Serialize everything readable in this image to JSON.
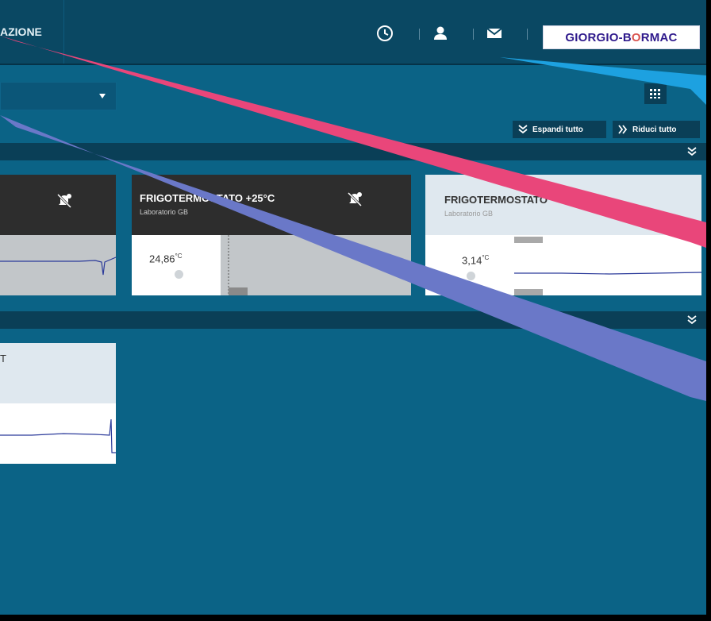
{
  "nav": {
    "configuration_tab_label": "AZIONE"
  },
  "brand": {
    "logo_part1": "GIORGIO-B",
    "logo_o": "O",
    "logo_part2": "RMAC"
  },
  "toolbar": {
    "expand_all_label": "Espandi tutto",
    "collapse_all_label": "Riduci tutto"
  },
  "cards": [
    {
      "title": "",
      "subtitle": "",
      "reading": "",
      "unit": ""
    },
    {
      "title": "FRIGOTERMOSTATO +25°C",
      "subtitle": "Laboratorio GB",
      "reading": "24,86",
      "unit": "°C"
    },
    {
      "title": "FRIGOTERMOSTATO",
      "subtitle": "Laboratorio GB",
      "reading": "3,14",
      "unit": "°C"
    }
  ],
  "card_lower": {
    "title": "T"
  },
  "colors": {
    "background": "#0b6386",
    "topbar": "#0a4863",
    "section_bar": "#0a3f57",
    "card_dark": "#2d2d2d",
    "card_light": "#dfe8ef",
    "arrow_blue": "#1da1e0",
    "arrow_pink": "#e9467a",
    "arrow_purple": "#6a78c8"
  },
  "icons": [
    "clock-icon",
    "user-icon",
    "mail-icon",
    "dropdown-arrow-icon",
    "grid-view-icon",
    "expand-icon",
    "collapse-icon",
    "chevron-down-double-icon",
    "bell-muted-icon",
    "refresh-icon"
  ]
}
